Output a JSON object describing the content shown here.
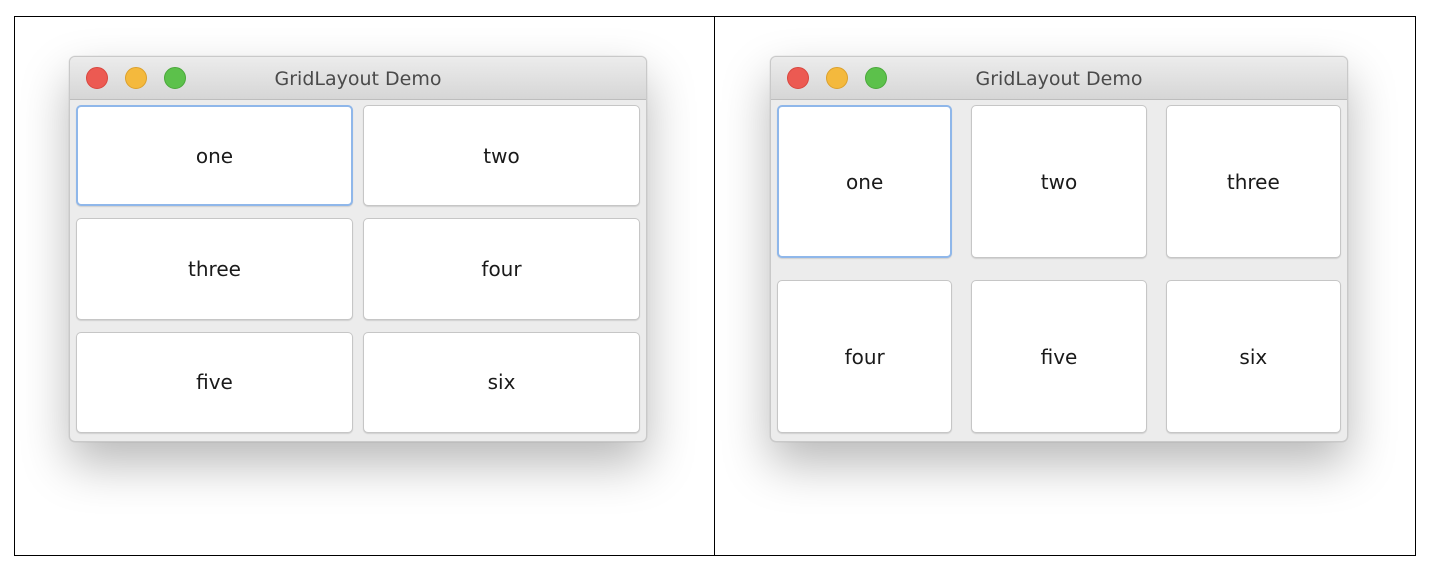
{
  "left_window": {
    "title": "GridLayout Demo",
    "buttons": [
      "one",
      "two",
      "three",
      "four",
      "five",
      "six"
    ]
  },
  "right_window": {
    "title": "GridLayout Demo",
    "buttons": [
      "one",
      "two",
      "three",
      "four",
      "five",
      "six"
    ]
  },
  "colors": {
    "close": "#ec5a52",
    "minimize": "#f4b93d",
    "zoom": "#5cc14b",
    "focus_ring": "#8fb7ea"
  },
  "icons": {
    "close": "close-icon",
    "minimize": "minimize-icon",
    "zoom": "zoom-icon"
  }
}
